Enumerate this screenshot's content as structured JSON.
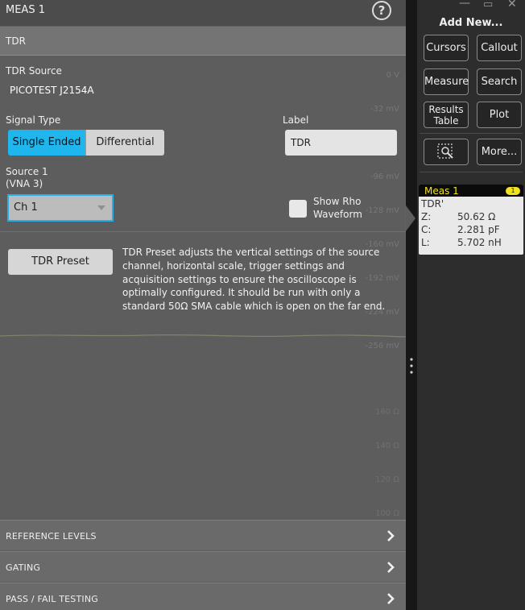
{
  "panel": {
    "title": "MEAS 1",
    "section": "TDR",
    "tdr_source_label": "TDR Source",
    "tdr_source_value": "PICOTEST J2154A",
    "signal_type_label": "Signal Type",
    "signal_type_options": [
      "Single Ended",
      "Differential"
    ],
    "signal_type_selected": "Single Ended",
    "label_label": "Label",
    "label_value": "TDR",
    "source1_label_line1": "Source 1",
    "source1_label_line2": "(VNA 3)",
    "source1_value": "Ch 1",
    "show_rho_line1": "Show Rho",
    "show_rho_line2": "Waveform",
    "tdr_preset_button": "TDR Preset",
    "tdr_preset_description": "TDR Preset adjusts the vertical settings of the source channel, horizontal scale, trigger settings and acquisition settings to ensure the oscilloscope is optimally configured. It should be run with only a standard 50Ω SMA cable which is open on the far end.",
    "accordions": [
      "REFERENCE LEVELS",
      "GATING",
      "PASS / FAIL TESTING"
    ]
  },
  "ghost_axis": [
    "0 V",
    "-32 mV",
    "-96 mV",
    "-128 mV",
    "-160 mV",
    "-192 mV",
    "-224 mV",
    "-256 mV",
    "160 Ω",
    "140 Ω",
    "120 Ω",
    "100 Ω"
  ],
  "sidebar": {
    "add_new_title": "Add New...",
    "buttons": {
      "cursors": "Cursors",
      "callout": "Callout",
      "measure": "Measure",
      "search": "Search",
      "results_line1": "Results",
      "results_line2": "Table",
      "plot": "Plot",
      "more": "More..."
    },
    "badge": {
      "title": "Meas 1",
      "number": "1",
      "subtitle": "TDR'",
      "rows": [
        {
          "k": "Z:",
          "v": "50.62 Ω"
        },
        {
          "k": "C:",
          "v": "2.281 pF"
        },
        {
          "k": "L:",
          "v": "5.702 nH"
        }
      ]
    }
  },
  "colors": {
    "accent": "#1fb6ee",
    "badge_yellow": "#f2e21c",
    "panel_bg": "#5d5d5d"
  }
}
